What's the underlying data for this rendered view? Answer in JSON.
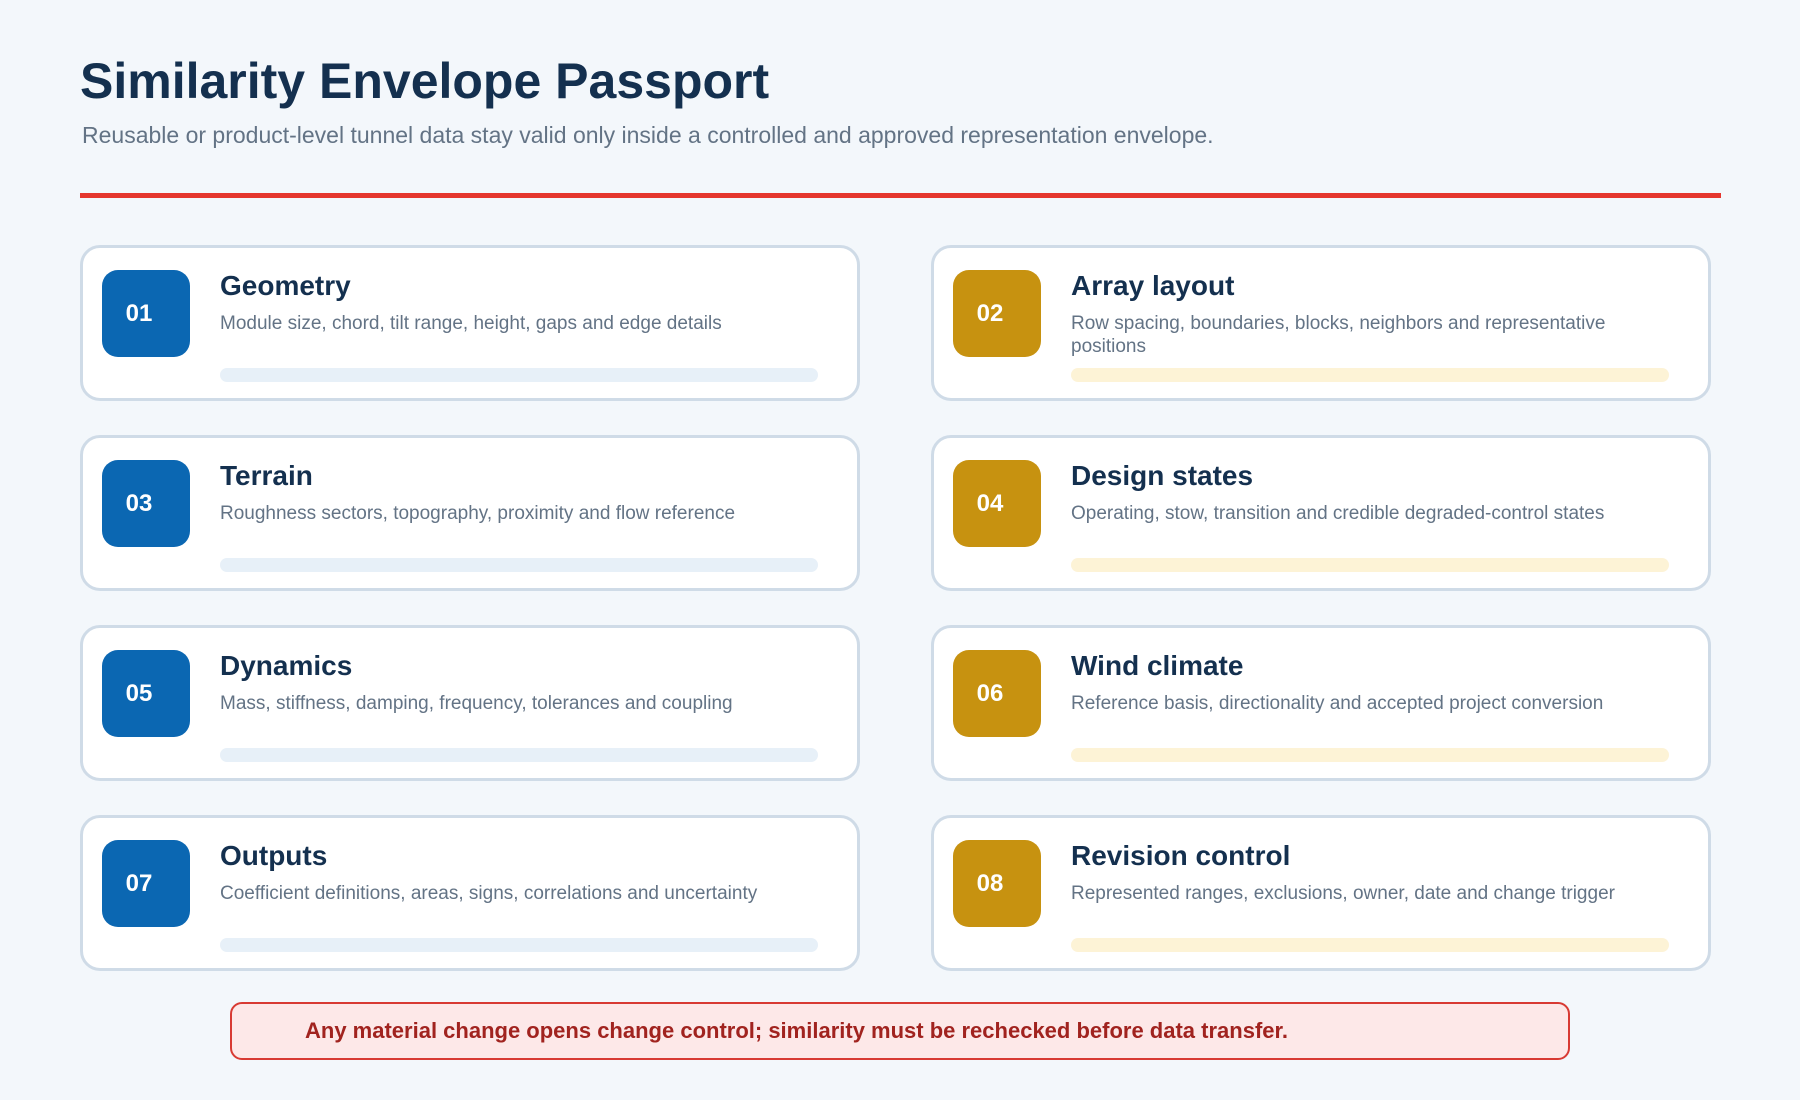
{
  "header": {
    "title": "Similarity Envelope Passport",
    "subtitle": "Reusable or product-level tunnel data stay valid only inside a controlled and approved representation envelope."
  },
  "colors": {
    "accent_rule": "#e5362e",
    "badge_blue": "#0b67b2",
    "badge_gold": "#c79210",
    "title_text": "#14304f",
    "callout_text": "#a1231f"
  },
  "cards": [
    {
      "number": "01",
      "title": "Geometry",
      "description": "Module size, chord, tilt range, height, gaps and edge details",
      "color": "blue"
    },
    {
      "number": "02",
      "title": "Array layout",
      "description": "Row spacing, boundaries, blocks, neighbors and representative positions",
      "color": "gold"
    },
    {
      "number": "03",
      "title": "Terrain",
      "description": "Roughness sectors, topography, proximity and flow reference",
      "color": "blue"
    },
    {
      "number": "04",
      "title": "Design states",
      "description": "Operating, stow, transition and credible degraded-control states",
      "color": "gold"
    },
    {
      "number": "05",
      "title": "Dynamics",
      "description": "Mass, stiffness, damping, frequency, tolerances and coupling",
      "color": "blue"
    },
    {
      "number": "06",
      "title": "Wind climate",
      "description": "Reference basis, directionality and accepted project conversion",
      "color": "gold"
    },
    {
      "number": "07",
      "title": "Outputs",
      "description": "Coefficient definitions, areas, signs, correlations and uncertainty",
      "color": "blue"
    },
    {
      "number": "08",
      "title": "Revision control",
      "description": "Represented ranges, exclusions, owner, date and change trigger",
      "color": "gold"
    }
  ],
  "callout": {
    "text": "Any material change opens change control; similarity must be rechecked before data transfer."
  }
}
